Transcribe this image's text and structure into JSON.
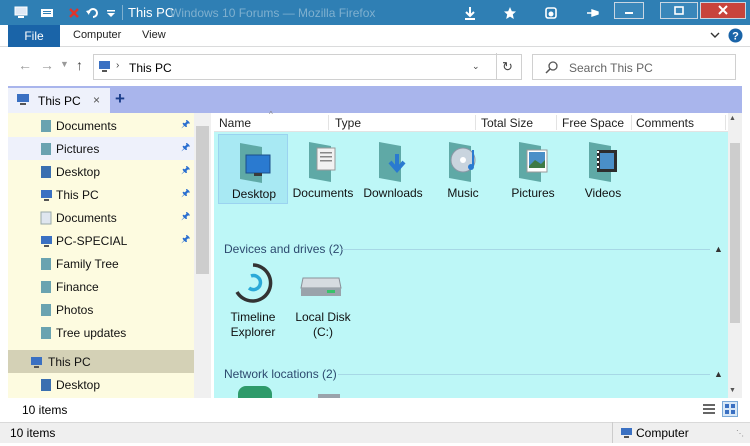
{
  "window": {
    "title": "This PC",
    "background_title": "Windows 10 Forums — Mozilla Firefox",
    "colors": {
      "titlebar": "#2f7fb4",
      "close": "#c8443c",
      "accent": "#1a64a8"
    }
  },
  "ribbon": {
    "tabs": [
      "File",
      "Computer",
      "View"
    ]
  },
  "address": {
    "path": "This PC",
    "search_placeholder": "Search This PC"
  },
  "tab": {
    "label": "This PC"
  },
  "navpane": {
    "items": [
      {
        "label": "Documents",
        "icon": "documents-icon",
        "pinned": true
      },
      {
        "label": "Pictures",
        "icon": "pictures-icon",
        "pinned": true
      },
      {
        "label": "Desktop",
        "icon": "desktop-icon",
        "pinned": true
      },
      {
        "label": "This PC",
        "icon": "pc-icon",
        "pinned": true
      },
      {
        "label": "Documents",
        "icon": "documents-icon",
        "pinned": true
      },
      {
        "label": "PC-SPECIAL",
        "icon": "pc-icon",
        "pinned": true
      },
      {
        "label": "Family Tree",
        "icon": "folder-icon",
        "pinned": false
      },
      {
        "label": "Finance",
        "icon": "folder-icon",
        "pinned": false
      },
      {
        "label": "Photos",
        "icon": "folder-icon",
        "pinned": false
      },
      {
        "label": "Tree updates",
        "icon": "folder-icon",
        "pinned": false
      },
      {
        "label": "This PC",
        "icon": "pc-icon",
        "pinned": false
      },
      {
        "label": "Desktop",
        "icon": "desktop-icon",
        "pinned": false
      }
    ]
  },
  "columns": [
    "Name",
    "Type",
    "Total Size",
    "Free Space",
    "Comments"
  ],
  "folders": [
    {
      "label": "Desktop",
      "icon": "desktop-folder-icon"
    },
    {
      "label": "Documents",
      "icon": "documents-folder-icon"
    },
    {
      "label": "Downloads",
      "icon": "downloads-folder-icon"
    },
    {
      "label": "Music",
      "icon": "music-folder-icon"
    },
    {
      "label": "Pictures",
      "icon": "pictures-folder-icon"
    },
    {
      "label": "Videos",
      "icon": "videos-folder-icon"
    }
  ],
  "groups": {
    "devices": "Devices and drives (2)",
    "network": "Network locations (2)"
  },
  "devices": [
    {
      "line1": "Timeline",
      "line2": "Explorer",
      "icon": "timeline-icon"
    },
    {
      "line1": "Local Disk",
      "line2": "(C:)",
      "icon": "disk-icon"
    }
  ],
  "status": {
    "item_count": "10 items",
    "item_count_bottom": "10 items",
    "location": "Computer"
  }
}
